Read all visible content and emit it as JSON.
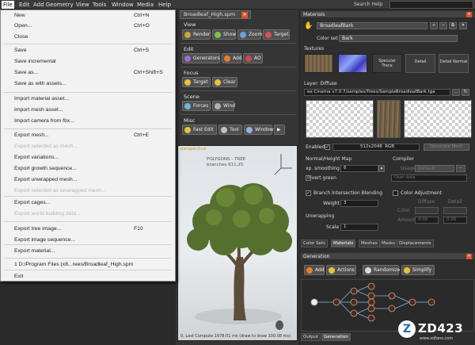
{
  "menubar": {
    "items": [
      "File",
      "Edit",
      "Add Geometry",
      "View",
      "Tools",
      "Window",
      "Media",
      "Help"
    ],
    "search_help": "Search Help"
  },
  "file_menu": {
    "items": [
      {
        "label": "New",
        "shortcut": "Ctrl+N",
        "enabled": true
      },
      {
        "label": "Open...",
        "shortcut": "Ctrl+O",
        "enabled": true
      },
      {
        "label": "Close",
        "shortcut": "",
        "enabled": true
      },
      {
        "label": "Save",
        "shortcut": "Ctrl+S",
        "enabled": true
      },
      {
        "label": "Save incremental",
        "shortcut": "",
        "enabled": true
      },
      {
        "label": "Save as...",
        "shortcut": "Ctrl+Shift+S",
        "enabled": true
      },
      {
        "label": "Save as with assets...",
        "shortcut": "",
        "enabled": true
      },
      {
        "label": "Import material asset...",
        "shortcut": "",
        "enabled": true
      },
      {
        "label": "Import mesh asset...",
        "shortcut": "",
        "enabled": true
      },
      {
        "label": "Import camera from fbx...",
        "shortcut": "",
        "enabled": true
      },
      {
        "label": "Export mesh...",
        "shortcut": "Ctrl+E",
        "enabled": true
      },
      {
        "label": "Export selected as mesh...",
        "shortcut": "",
        "enabled": false
      },
      {
        "label": "Export variations...",
        "shortcut": "",
        "enabled": true
      },
      {
        "label": "Export growth sequence...",
        "shortcut": "",
        "enabled": true
      },
      {
        "label": "Export unwrapped mesh...",
        "shortcut": "",
        "enabled": true
      },
      {
        "label": "Export selected as unwrapped mesh...",
        "shortcut": "",
        "enabled": false
      },
      {
        "label": "Export cages...",
        "shortcut": "",
        "enabled": true
      },
      {
        "label": "Export world building data...",
        "shortcut": "",
        "enabled": false
      },
      {
        "label": "Export tree image...",
        "shortcut": "F10",
        "enabled": true
      },
      {
        "label": "Export image sequence...",
        "shortcut": "",
        "enabled": true
      },
      {
        "label": "Export material...",
        "shortcut": "",
        "enabled": true
      },
      {
        "label": "1 D:/Program Files (x8...rees/Broadleaf_High.spm",
        "shortcut": "",
        "enabled": true
      },
      {
        "label": "Exit",
        "shortcut": "",
        "enabled": true
      }
    ]
  },
  "document_tab": {
    "title": "Broadleaf_High.spm",
    "close": "✕"
  },
  "view_section": {
    "title": "View",
    "buttons": [
      "Render",
      "Show",
      "Zoom",
      "Target"
    ]
  },
  "edit_section": {
    "title": "Edit",
    "buttons": [
      "Generators",
      "Add",
      "AO"
    ]
  },
  "focus_section": {
    "title": "Focus",
    "buttons": [
      "Target",
      "Clear"
    ]
  },
  "scene_section": {
    "title": "Scene",
    "buttons": [
      "Forces",
      "Wind"
    ]
  },
  "misc_section": {
    "title": "Misc",
    "buttons": [
      "Fast Edit",
      "Tool",
      "Window",
      "▶"
    ]
  },
  "viewport": {
    "mode_label": "perspective",
    "stats_line1": "POLYGONS - TREE",
    "stats_line2": "branches 611,25",
    "footer": "0, Last Compute 1978.01 ms (draw to draw 100.08 ms)"
  },
  "materials": {
    "title": "Materials",
    "selected_material": "BroadleafBark",
    "color_set_label": "Color set",
    "color_set_value": "Bark",
    "textures_label": "Textures",
    "texture_buttons": [
      "Specular Trans",
      "Detail",
      "Detail Normal"
    ],
    "layer_label": "Layer: Diffuse",
    "texture_path": "ee Cinema v7.0.7/samples/Trees/SampleBroadleafBark.tga",
    "enabled_label": "Enabled",
    "enabled_checked": true,
    "resolution": "512x2048",
    "format": "RGB",
    "generate_mesh": "Generate Mesh",
    "normal_height_map": "Normal/Height Map",
    "smoothing_label": "xp. smoothing",
    "smoothing_value": "6",
    "invert_green": "Invert green",
    "compiler_label": "Compiler",
    "usage_label": "Usage",
    "usage_value": "Default",
    "user_data": "User data",
    "branch_blending": "Branch Intersection Blending",
    "weight_label": "Weight",
    "weight_value": "3",
    "unwrapping_label": "Unwrapping",
    "scale_label": "Scale",
    "scale_value": "1",
    "color_adjustment": "Color Adjustment",
    "diffuse_label": "Diffuse",
    "detail_label": "Detail",
    "color_label": "Color",
    "amount_label": "Amount",
    "amount_a": "0.00",
    "amount_b": "0.00"
  },
  "material_tabs": [
    "Color Sets",
    "Materials",
    "Meshes",
    "Masks",
    "Displacements"
  ],
  "generation": {
    "title": "Generation",
    "buttons": [
      "Add",
      "Actions",
      "Randomize",
      "Simplify"
    ]
  },
  "bottom_tabs": [
    "Output",
    "Generation"
  ],
  "watermark": {
    "logo": "Z",
    "text": "ZD423",
    "sub": "www.zdfans.com"
  }
}
